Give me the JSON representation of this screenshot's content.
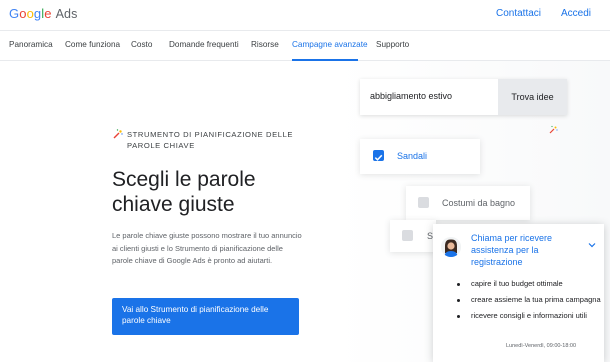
{
  "header": {
    "logo_text": "Google",
    "logo_product": "Ads",
    "contact_label": "Contattaci",
    "login_label": "Accedi"
  },
  "nav": {
    "items": [
      {
        "label": "Panoramica"
      },
      {
        "label": "Come funziona"
      },
      {
        "label": "Costo"
      },
      {
        "label": "Domande frequenti"
      },
      {
        "label": "Risorse"
      },
      {
        "label": "Campagne avanzate",
        "active": true
      },
      {
        "label": "Supporto"
      }
    ]
  },
  "hero": {
    "eyebrow": "Strumento di pianificazione delle parole chiave",
    "headline": "Scegli le parole chiave giuste",
    "description": "Le parole chiave giuste possono mostrare il tuo annuncio ai clienti giusti e lo Strumento di pianificazione delle parole chiave di Google Ads è pronto ad aiutarti.",
    "cta_label": "Vai allo Strumento di pianificazione delle parole chiave"
  },
  "search": {
    "value": "abbigliamento estivo",
    "button_label": "Trova idee"
  },
  "keywords": [
    {
      "label": "Sandali",
      "checked": true
    },
    {
      "label": "Costumi da bagno",
      "checked": false
    },
    {
      "label": "S",
      "checked": false
    }
  ],
  "help": {
    "title": "Chiama per ricevere assistenza per la registrazione",
    "items": [
      "capire il tuo budget ottimale",
      "creare assieme la tua prima campagna",
      "ricevere consigli e informazioni utili"
    ],
    "hours": "Lunedì-Venerdì, 09:00-18:00"
  },
  "colors": {
    "accent": "#1a73e8",
    "text": "#202124",
    "muted": "#5f6368"
  },
  "icons": {
    "tool": "keyword-planner-icon",
    "sparkle": "sparkle-icon",
    "chevron": "chevron-down-icon"
  }
}
